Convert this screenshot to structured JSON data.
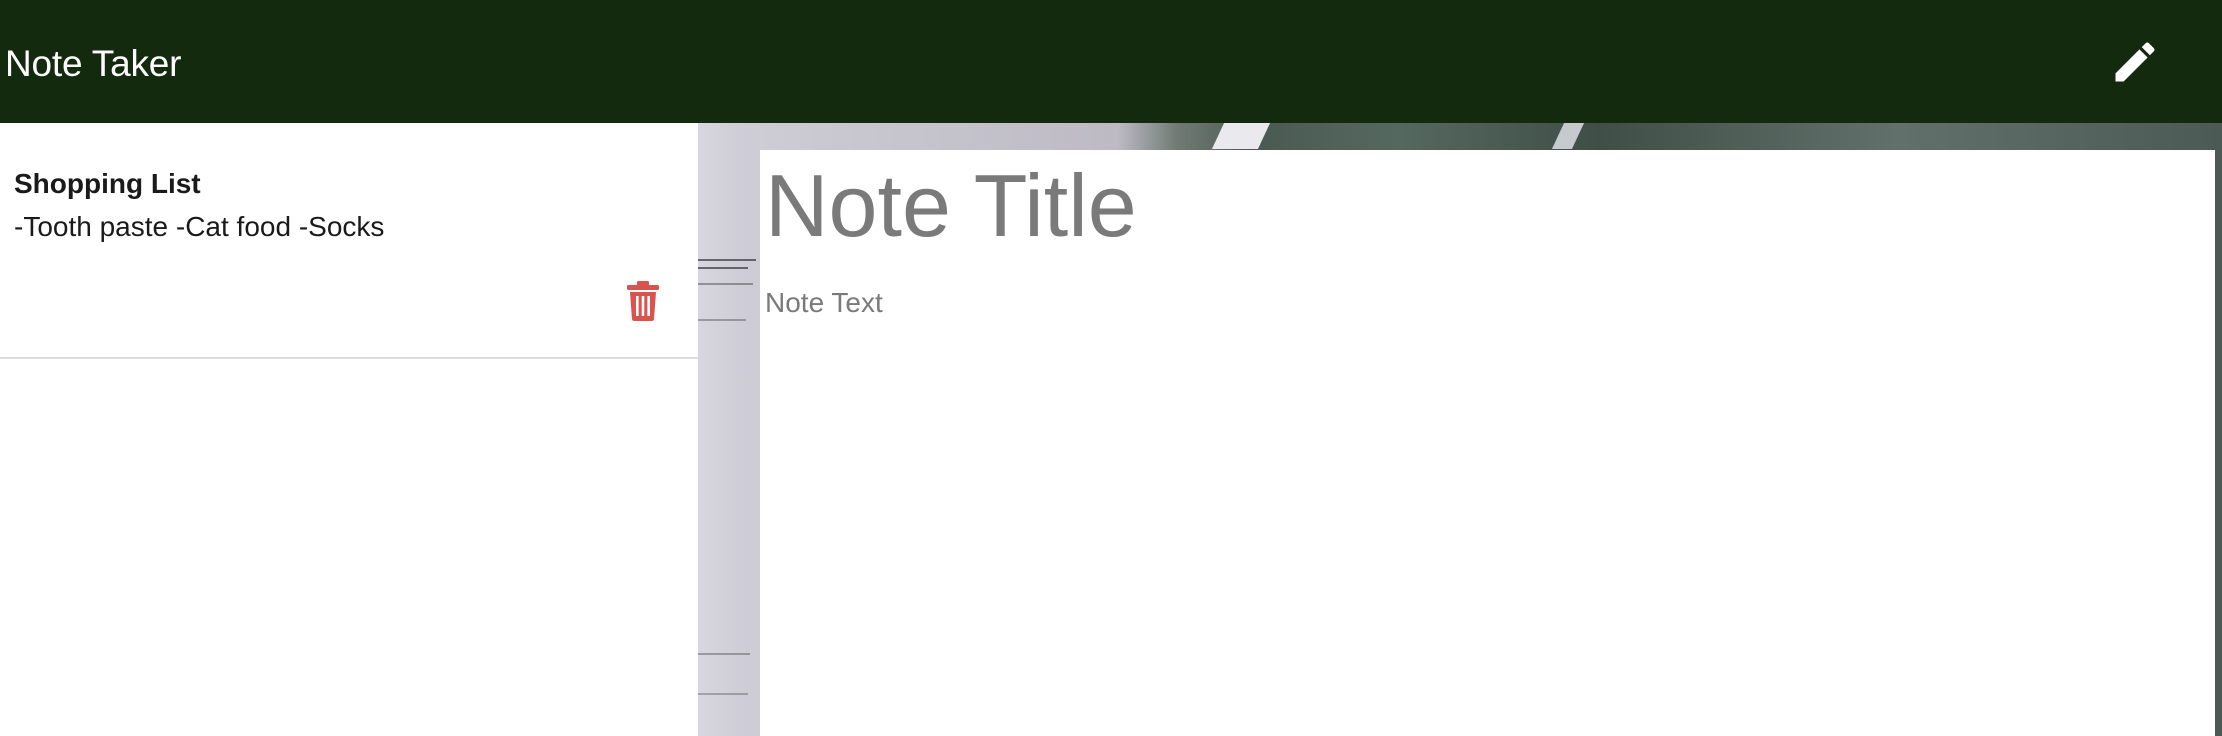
{
  "navbar": {
    "brand": "Note Taker",
    "new_note_icon": "pencil-icon",
    "background_color": "#132a0f"
  },
  "sidebar": {
    "notes": [
      {
        "title": "Shopping List",
        "text": "-Tooth paste -Cat food -Socks",
        "delete_icon": "trash-icon"
      }
    ],
    "delete_color": "#d9534f"
  },
  "editor": {
    "title_placeholder": "Note Title",
    "text_placeholder": "Note Text"
  }
}
